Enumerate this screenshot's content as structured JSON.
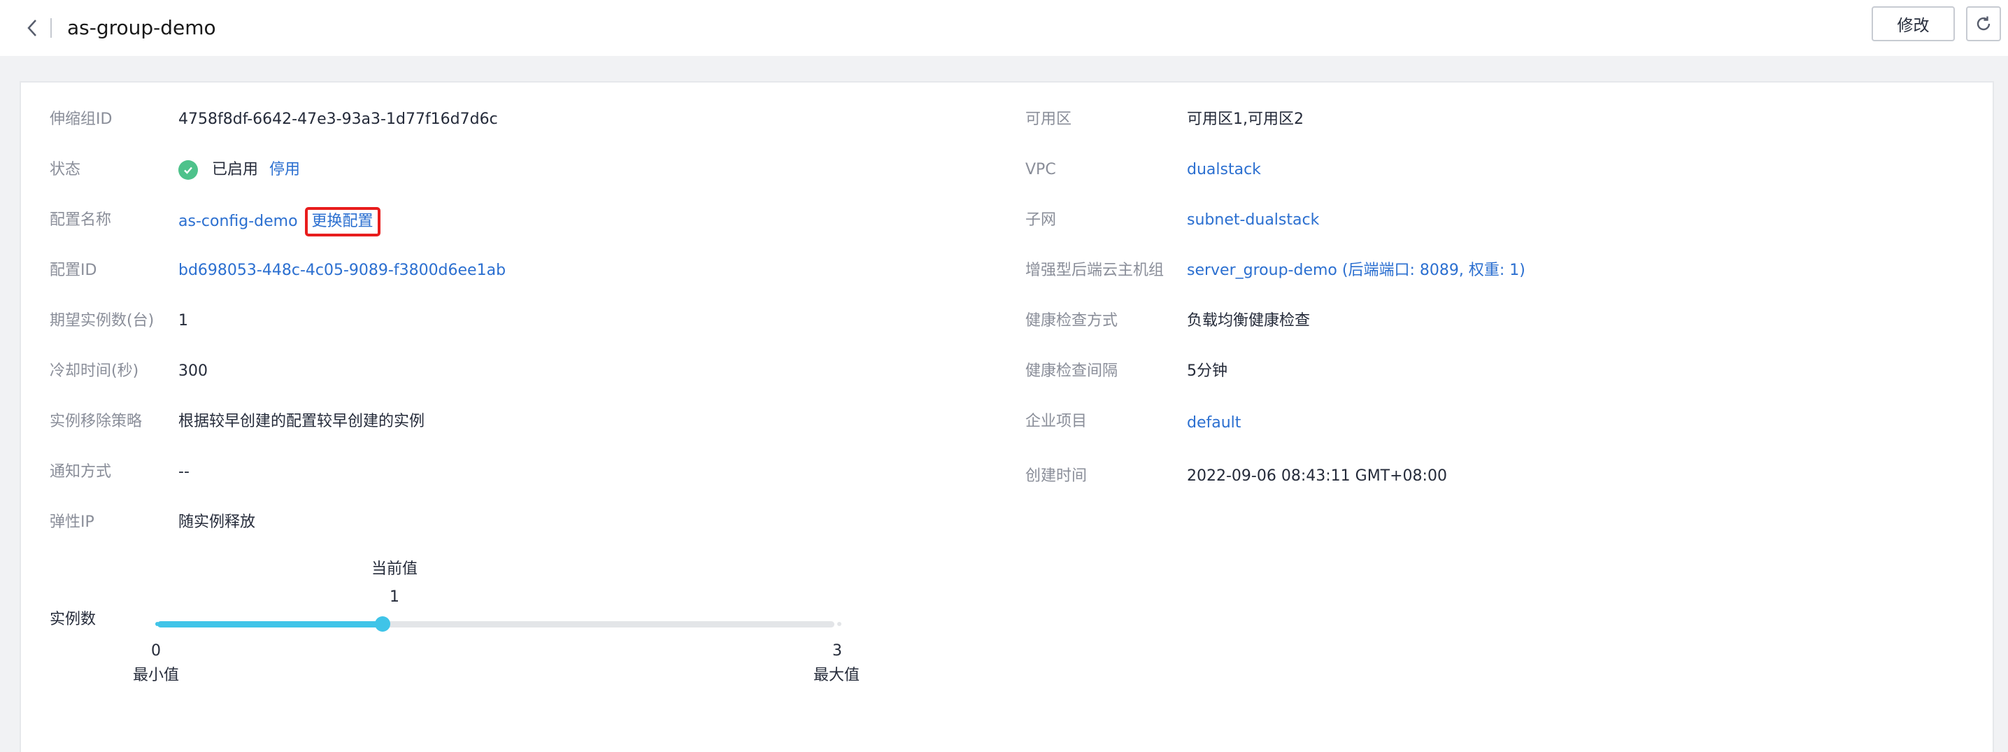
{
  "header": {
    "title": "as-group-demo",
    "modify_label": "修改"
  },
  "left": {
    "group_id_label": "伸缩组ID",
    "group_id_value": "4758f8df-6642-47e3-93a3-1d77f16d7d6c",
    "status_label": "状态",
    "status_value": "已启用",
    "status_action": "停用",
    "config_name_label": "配置名称",
    "config_name_value": "as-config-demo",
    "config_change_link": "更换配置",
    "config_id_label": "配置ID",
    "config_id_value": "bd698053-448c-4c05-9089-f3800d6ee1ab",
    "desired_label": "期望实例数(台)",
    "desired_value": "1",
    "cooldown_label": "冷却时间(秒)",
    "cooldown_value": "300",
    "removal_label": "实例移除策略",
    "removal_value": "根据较早创建的配置较早创建的实例",
    "notify_label": "通知方式",
    "notify_value": "--",
    "eip_label": "弹性IP",
    "eip_value": "随实例释放",
    "instances_label": "实例数"
  },
  "slider": {
    "current_label": "当前值",
    "current_value": "1",
    "min_value": "0",
    "min_label": "最小值",
    "max_value": "3",
    "max_label": "最大值",
    "fill_fraction": 0.333,
    "color": "#3fc4e8"
  },
  "right": {
    "az_label": "可用区",
    "az_value": "可用区1,可用区2",
    "vpc_label": "VPC",
    "vpc_value": "dualstack",
    "subnet_label": "子网",
    "subnet_value": "subnet-dualstack",
    "lb_label": "增强型后端云主机组",
    "lb_value": "server_group-demo (后端端口: 8089, 权重: 1)",
    "health_method_label": "健康检查方式",
    "health_method_value": "负载均衡健康检查",
    "health_interval_label": "健康检查间隔",
    "health_interval_value": "5分钟",
    "enterprise_label": "企业项目",
    "enterprise_value": "default",
    "created_label": "创建时间",
    "created_value": "2022-09-06 08:43:11 GMT+08:00"
  },
  "colors": {
    "link": "#2b6fd0",
    "status_ok": "#4ec28b",
    "highlight": "#e81d1d"
  },
  "icons": {
    "back": "chevron-left-icon",
    "refresh": "refresh-icon",
    "status": "check-circle-icon"
  }
}
